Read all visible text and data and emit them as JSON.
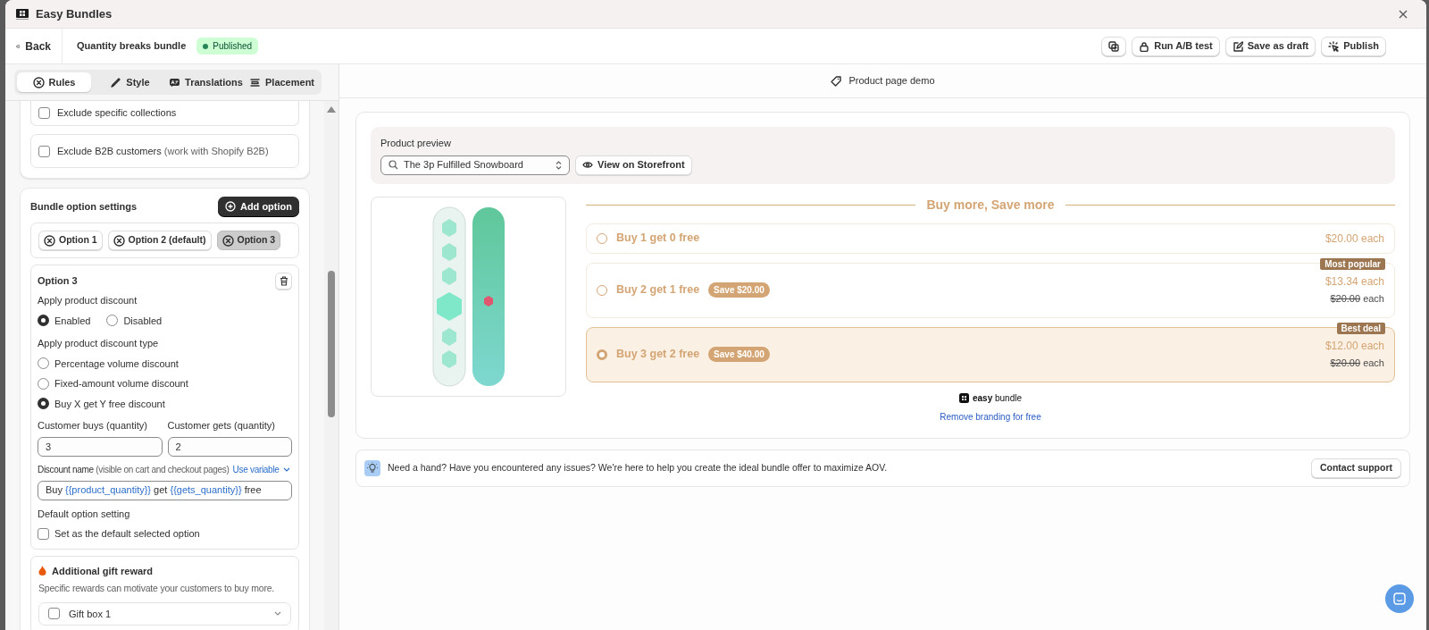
{
  "window": {
    "title": "Easy Bundles"
  },
  "header": {
    "back": "Back",
    "bundle_name": "Quantity breaks bundle",
    "status": "Published",
    "actions": [
      {
        "kind": "duplicate"
      },
      {
        "kind": "lock",
        "label": "Run A/B test"
      },
      {
        "kind": "edit",
        "label": "Save as draft"
      },
      {
        "kind": "publish",
        "label": "Publish"
      }
    ]
  },
  "tabs": [
    {
      "kind": "rules",
      "label": "Rules",
      "selected": true
    },
    {
      "kind": "style",
      "label": "Style",
      "selected": false
    },
    {
      "kind": "translations",
      "label": "Translations",
      "selected": false
    },
    {
      "kind": "placement",
      "label": "Placement",
      "selected": false
    }
  ],
  "exclusions": [
    {
      "label": "Exclude specific collections",
      "checked": false
    },
    {
      "label": "Exclude B2B customers",
      "note": "(work with Shopify B2B)",
      "checked": false
    }
  ],
  "bundle_options": {
    "title": "Bundle option settings",
    "add_button": "Add option",
    "options": [
      {
        "label": "Option 1",
        "selected": false
      },
      {
        "label": "Option 2 (default)",
        "selected": false
      },
      {
        "label": "Option 3",
        "selected": true
      }
    ],
    "detail": {
      "title": "Option 3",
      "apply_discount": {
        "label": "Apply product discount",
        "choices": [
          {
            "label": "Enabled",
            "selected": true
          },
          {
            "label": "Disabled",
            "selected": false
          }
        ]
      },
      "discount_type": {
        "label": "Apply product discount type",
        "choices": [
          {
            "label": "Percentage volume discount",
            "selected": false
          },
          {
            "label": "Fixed-amount volume discount",
            "selected": false
          },
          {
            "label": "Buy X get Y free discount",
            "selected": true
          }
        ]
      },
      "buys": {
        "label": "Customer buys (quantity)",
        "value": "3"
      },
      "gets": {
        "label": "Customer gets (quantity)",
        "value": "2"
      },
      "discount_name": {
        "label": "Discount name",
        "note": "(visible on cart and checkout pages)",
        "link": "Use variable",
        "segments": [
          {
            "kind": "plain",
            "text": "Buy "
          },
          {
            "kind": "variable",
            "text": "{{product_quantity}}"
          },
          {
            "kind": "plain",
            "text": " get "
          },
          {
            "kind": "variable",
            "text": "{{gets_quantity}}"
          },
          {
            "kind": "plain",
            "text": " free"
          }
        ]
      },
      "default_setting": {
        "label": "Default option setting",
        "checkbox": "Set as the default selected option",
        "checked": false
      }
    }
  },
  "gift": {
    "title": "Additional gift reward",
    "description": "Specific rewards can motivate your customers to buy more.",
    "items": [
      {
        "label": "Gift box 1",
        "checked": false
      }
    ]
  },
  "preview": {
    "heading": "Product page demo",
    "product_label": "Product preview",
    "product": "The 3p Fulfilled Snowboard",
    "view_button": "View on Storefront",
    "offer_title": "Buy more, Save more",
    "offers": [
      {
        "label": "Buy 1 get 0 free",
        "price": "$20.00 each",
        "selected": false
      },
      {
        "label": "Buy 2 get 1 free",
        "save": "Save $20.00",
        "badge": "Most popular",
        "price": "$13.34 each",
        "original": "$20.00",
        "original_suffix": "each",
        "selected": false
      },
      {
        "label": "Buy 3 get 2 free",
        "save": "Save $40.00",
        "badge": "Best deal",
        "price": "$12.00 each",
        "original": "$20.00",
        "original_suffix": "each",
        "selected": true
      }
    ],
    "brand": {
      "bold": "easy",
      "rest": "bundle"
    },
    "remove_link": "Remove branding for free"
  },
  "help": {
    "text": "Need a hand? Have you encountered any issues? We're here to help you create the ideal bundle offer to maximize AOV.",
    "button": "Contact support"
  }
}
